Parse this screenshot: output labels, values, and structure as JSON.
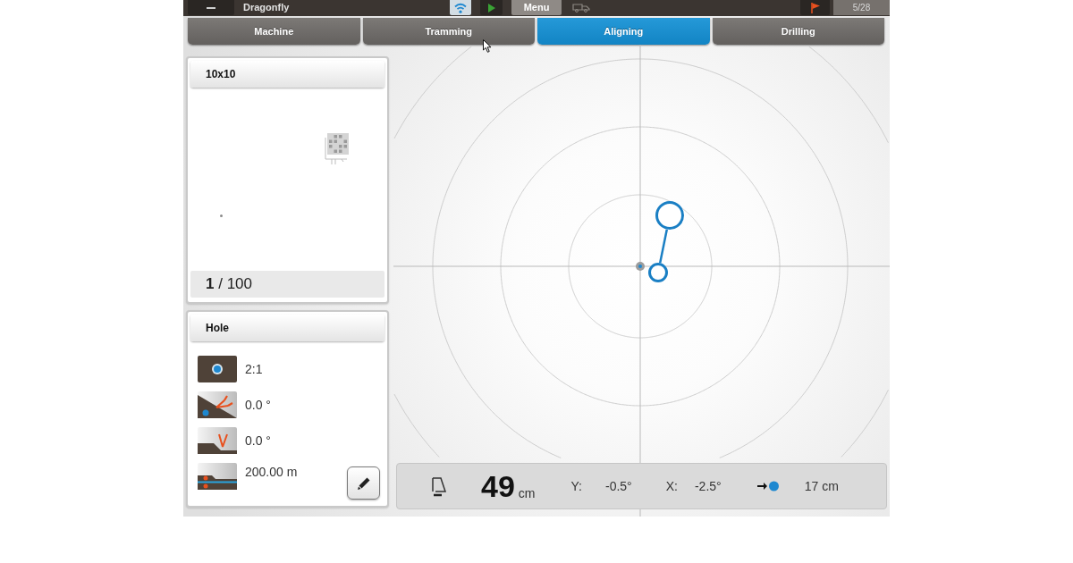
{
  "top_bar": {
    "title": "Dragonfly",
    "menu_label": "Menu",
    "counter": "5/28"
  },
  "tabs": [
    {
      "label": "Machine",
      "selected": false
    },
    {
      "label": "Tramming",
      "selected": false
    },
    {
      "label": "Aligning",
      "selected": true
    },
    {
      "label": "Drilling",
      "selected": false
    }
  ],
  "plan_panel": {
    "title": "10x10",
    "progress": "**1** / 100"
  },
  "hole_panel": {
    "title": "Hole",
    "params": [
      {
        "kind": "pattern",
        "value": "2:1"
      },
      {
        "kind": "inclination",
        "value": "0.0 °"
      },
      {
        "kind": "azimuth",
        "value": "0.0 °"
      },
      {
        "kind": "depth",
        "value": "200.00 m"
      }
    ]
  },
  "status_bar": {
    "distance": "49",
    "distance_unit": "cm",
    "y_label": "Y:",
    "y_value": "-0.5°",
    "x_label": "X:",
    "x_value": "-2.5°",
    "offset": "17 cm"
  }
}
